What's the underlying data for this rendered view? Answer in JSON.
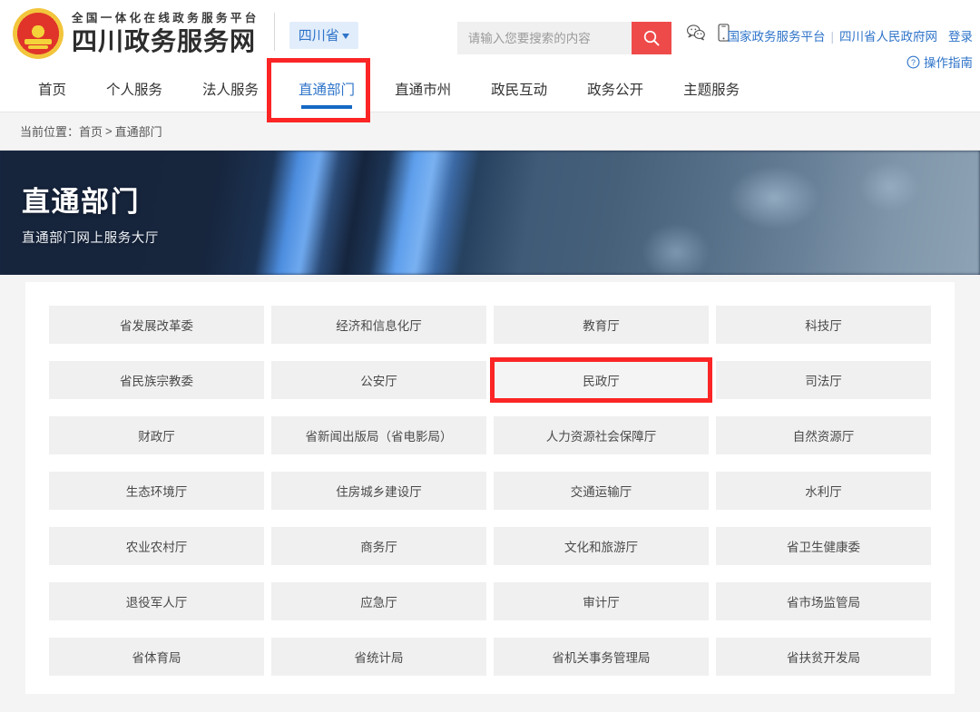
{
  "header": {
    "emblem_icon": "china-national-emblem",
    "brand_sub": "全国一体化在线政务服务平台",
    "brand_main": "四川政务服务网",
    "region_label": "四川省",
    "region_caret_icon": "caret-down-icon",
    "search_placeholder": "请输入您要搜索的内容",
    "search_value": "",
    "search_icon": "search-icon",
    "wechat_icon": "wechat-icon",
    "mobile_icon": "mobile-phone-icon",
    "link_national": "国家政务服务平台",
    "link_separator": "|",
    "link_provincial": "四川省人民政府网",
    "link_login": "登录",
    "help_icon": "question-circle-icon",
    "link_guide": "操作指南"
  },
  "nav": {
    "items": [
      {
        "label": "首页",
        "active": false
      },
      {
        "label": "个人服务",
        "active": false
      },
      {
        "label": "法人服务",
        "active": false
      },
      {
        "label": "直通部门",
        "active": true
      },
      {
        "label": "直通市州",
        "active": false
      },
      {
        "label": "政民互动",
        "active": false
      },
      {
        "label": "政务公开",
        "active": false
      },
      {
        "label": "主题服务",
        "active": false
      }
    ]
  },
  "breadcrumb": {
    "prefix": "当前位置：",
    "home": "首页",
    "separator": ">",
    "current": "直通部门"
  },
  "banner": {
    "title": "直通部门",
    "subtitle": "直通部门网上服务大厅"
  },
  "departments": [
    "省发展改革委",
    "经济和信息化厅",
    "教育厅",
    "科技厅",
    "省民族宗教委",
    "公安厅",
    "民政厅",
    "司法厅",
    "财政厅",
    "省新闻出版局（省电影局）",
    "人力资源社会保障厅",
    "自然资源厅",
    "生态环境厅",
    "住房城乡建设厅",
    "交通运输厅",
    "水利厅",
    "农业农村厅",
    "商务厅",
    "文化和旅游厅",
    "省卫生健康委",
    "退役军人厅",
    "应急厅",
    "审计厅",
    "省市场监管局",
    "省体育局",
    "省统计局",
    "省机关事务管理局",
    "省扶贫开发局"
  ],
  "annotations": {
    "highlight_color": "#fb2525",
    "highlighted_nav_item": "直通部门",
    "highlighted_department": "民政厅"
  },
  "colors": {
    "brand_red": "#ef4a4a",
    "link_blue": "#2f74c9",
    "nav_active_blue": "#1668c4",
    "page_bg": "#f4f4f4",
    "cell_bg": "#f0f0f0"
  }
}
